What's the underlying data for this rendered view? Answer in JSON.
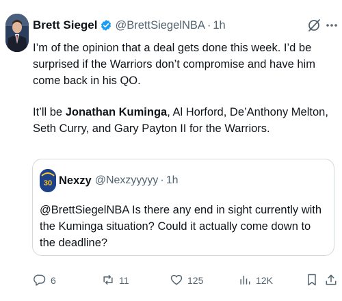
{
  "author": {
    "display_name": "Brett Siegel",
    "handle": "@BrettSiegelNBA",
    "separator": "·",
    "time": "1h"
  },
  "tweet": {
    "paragraph1": "I’m of the opinion that a deal gets done this week. I’d be surprised if the Warriors don’t compromise and have him come back in his QO.",
    "p2_prefix": "It’ll be ",
    "p2_bold": "Jonathan Kuminga",
    "p2_suffix": ", Al Horford, De’Anthony Melton, Seth Curry, and Gary Payton II for the Warriors."
  },
  "quoted": {
    "display_name": "Nexzy",
    "handle": "@Nexzyyyyy",
    "separator": "·",
    "time": "1h",
    "avatar_text": "30",
    "text": "@BrettSiegelNBA Is there any end in sight currently with the Kuminga situation? Could it actually come down to the deadline?"
  },
  "actions": {
    "replies": "6",
    "reposts": "11",
    "likes": "125",
    "views": "12K"
  },
  "icons": [
    "verified-badge-icon",
    "grok-icon",
    "more-icon",
    "reply-icon",
    "repost-icon",
    "like-icon",
    "views-icon",
    "bookmark-icon",
    "share-icon"
  ],
  "colors": {
    "verified": "#1d9bf0",
    "secondary_text": "#536471",
    "border": "#cfd9de"
  }
}
